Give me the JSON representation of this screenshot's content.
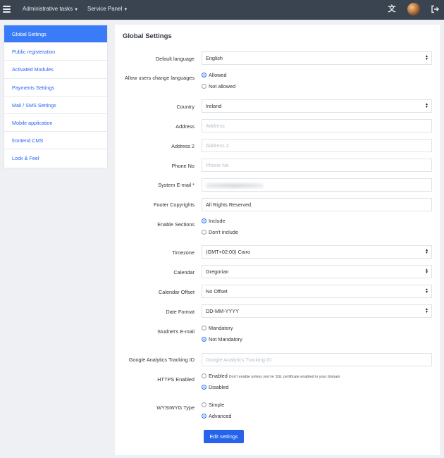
{
  "topbar": {
    "menus": [
      "Administrative tasks",
      "Service Panel"
    ]
  },
  "sidebar": {
    "items": [
      {
        "label": "Global Settings",
        "active": true
      },
      {
        "label": "Public registeration"
      },
      {
        "label": "Activated Modules"
      },
      {
        "label": "Payments Settings"
      },
      {
        "label": "Mail / SMS Settings"
      },
      {
        "label": "Mobile application"
      },
      {
        "label": "frontend CMS"
      },
      {
        "label": "Look & Feel"
      }
    ]
  },
  "main": {
    "title": "Global Settings",
    "default_language": {
      "label": "Default language",
      "value": "English"
    },
    "allow_change_language": {
      "label": "Allow users change languages",
      "options": [
        "Allowed",
        "Not allowed"
      ],
      "selected": "Allowed"
    },
    "country": {
      "label": "Country",
      "value": "Ireland"
    },
    "address": {
      "label": "Address",
      "placeholder": "Address",
      "value": ""
    },
    "address2": {
      "label": "Address 2",
      "placeholder": "Address 2",
      "value": ""
    },
    "phone": {
      "label": "Phone No",
      "placeholder": "Phone No",
      "value": ""
    },
    "system_email": {
      "label": "System E-mail *"
    },
    "footer_copyrights": {
      "label": "Footer Copyrights",
      "value": "All Rights Reserved."
    },
    "enable_sections": {
      "label": "Enable Sections",
      "options": [
        "Include",
        "Don't include"
      ],
      "selected": "Include"
    },
    "timezone": {
      "label": "Timezone",
      "value": "(GMT+02:00) Cairo"
    },
    "calendar": {
      "label": "Calendar",
      "value": "Gregorian"
    },
    "calendar_offset": {
      "label": "Calendar Offset",
      "value": "No Offset"
    },
    "date_format": {
      "label": "Date Format",
      "value": "DD-MM-YYYY"
    },
    "student_email": {
      "label": "Studnet's E-mail",
      "options": [
        "Mandatory",
        "Not Mandatory"
      ],
      "selected": "Not Mandatory"
    },
    "google_analytics": {
      "label": "Google Analytics Tracking ID",
      "placeholder": "Google Analytics Tracking ID",
      "value": ""
    },
    "https_enabled": {
      "label": "HTTPS Enabled",
      "options": [
        "Enabled",
        "Disabled"
      ],
      "note": "Don't enable unless you've SSL certificate enabled in your domain",
      "selected": "Disabled"
    },
    "wysiwyg_type": {
      "label": "WYSIWYG Type",
      "options": [
        "Simple",
        "Advanced"
      ],
      "selected": "Advanced"
    },
    "submit_label": "Edit settings"
  }
}
